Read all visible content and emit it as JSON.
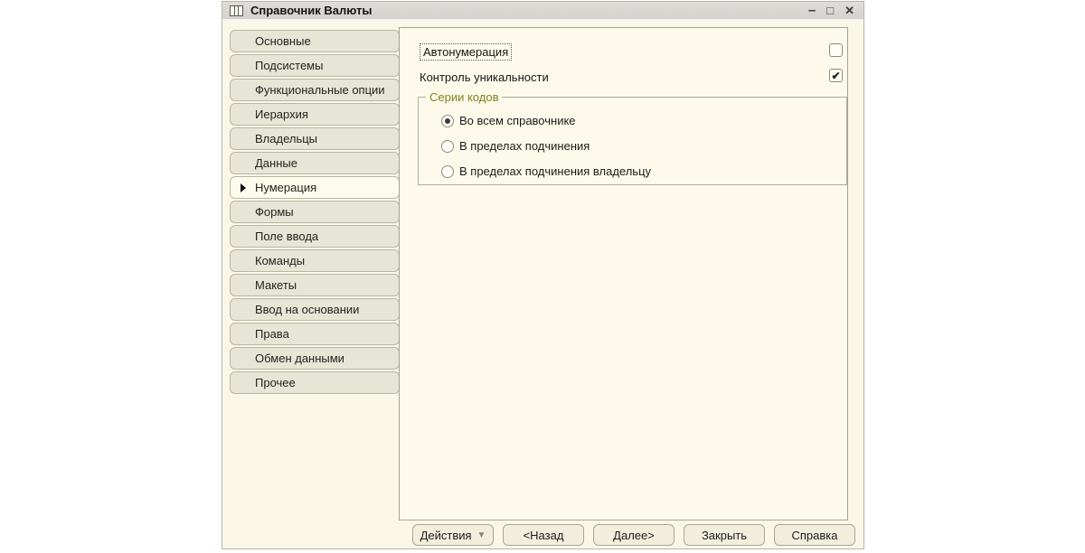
{
  "window": {
    "title": "Справочник Валюты",
    "controls": {
      "minimize": "–",
      "maximize": "□",
      "close": "✕"
    }
  },
  "tabs": {
    "items": [
      {
        "label": "Основные",
        "selected": false
      },
      {
        "label": "Подсистемы",
        "selected": false
      },
      {
        "label": "Функциональные опции",
        "selected": false
      },
      {
        "label": "Иерархия",
        "selected": false
      },
      {
        "label": "Владельцы",
        "selected": false
      },
      {
        "label": "Данные",
        "selected": false
      },
      {
        "label": "Нумерация",
        "selected": true
      },
      {
        "label": "Формы",
        "selected": false
      },
      {
        "label": "Поле ввода",
        "selected": false
      },
      {
        "label": "Команды",
        "selected": false
      },
      {
        "label": "Макеты",
        "selected": false
      },
      {
        "label": "Ввод на основании",
        "selected": false
      },
      {
        "label": "Права",
        "selected": false
      },
      {
        "label": "Обмен данными",
        "selected": false
      },
      {
        "label": "Прочее",
        "selected": false
      }
    ]
  },
  "content": {
    "autonumbering": {
      "label": "Автонумерация",
      "checked": false,
      "focused": true
    },
    "uniqueness": {
      "label": "Контроль уникальности",
      "checked": true
    },
    "code_series": {
      "group_label": "Серии кодов",
      "options": [
        {
          "label": "Во всем справочнике",
          "selected": true
        },
        {
          "label": "В пределах подчинения",
          "selected": false
        },
        {
          "label": "В пределах подчинения владельцу",
          "selected": false
        }
      ]
    },
    "check_glyph": "✔"
  },
  "footer": {
    "buttons": [
      {
        "label": "Действия",
        "dropdown": true
      },
      {
        "label": "<Назад",
        "dropdown": false
      },
      {
        "label": "Далее>",
        "dropdown": false
      },
      {
        "label": "Закрыть",
        "dropdown": false
      },
      {
        "label": "Справка",
        "dropdown": false
      }
    ],
    "dropdown_glyph": "▼"
  },
  "colors": {
    "window_bg": "#faf7e6",
    "panel_bg": "#fdfaeb",
    "tab_bg": "#e7e5d5",
    "titlebar_bg": "#d7d6d1",
    "group_label": "#82801f"
  }
}
